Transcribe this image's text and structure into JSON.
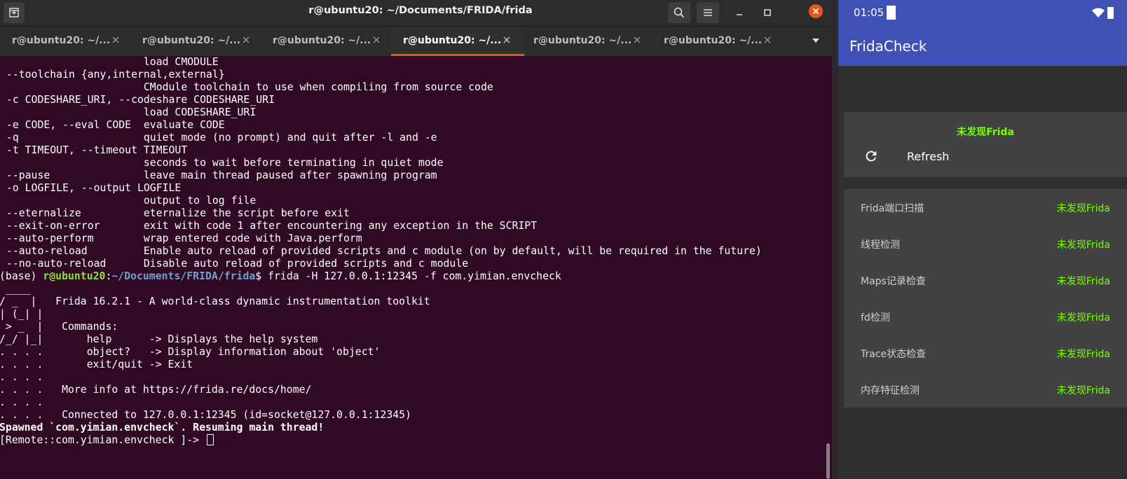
{
  "terminal": {
    "title": "r@ubuntu20: ~/Documents/FRIDA/frida",
    "tabs": [
      {
        "label": "r@ubuntu20: ~/...",
        "active": false
      },
      {
        "label": "r@ubuntu20: ~/...",
        "active": false
      },
      {
        "label": "r@ubuntu20: ~/...",
        "active": false
      },
      {
        "label": "r@ubuntu20: ~/...",
        "active": true
      },
      {
        "label": "r@ubuntu20: ~/...",
        "active": false
      },
      {
        "label": "r@ubuntu20: ~/...",
        "active": false
      }
    ],
    "lines": [
      "                       load CMODULE",
      " --toolchain {any,internal,external}",
      "                       CModule toolchain to use when compiling from source code",
      " -c CODESHARE_URI, --codeshare CODESHARE_URI",
      "                       load CODESHARE_URI",
      " -e CODE, --eval CODE  evaluate CODE",
      " -q                    quiet mode (no prompt) and quit after -l and -e",
      " -t TIMEOUT, --timeout TIMEOUT",
      "                       seconds to wait before terminating in quiet mode",
      " --pause               leave main thread paused after spawning program",
      " -o LOGFILE, --output LOGFILE",
      "                       output to log file",
      " --eternalize          eternalize the script before exit",
      " --exit-on-error       exit with code 1 after encountering any exception in the SCRIPT",
      " --auto-perform        wrap entered code with Java.perform",
      " --auto-reload         Enable auto reload of provided scripts and c module (on by default, will be required in the future)",
      " --no-auto-reload      Disable auto reload of provided scripts and c module"
    ],
    "prompt": {
      "env": "(base) ",
      "user_host": "r@ubuntu20",
      "colon": ":",
      "path": "~/Documents/FRIDA/frida",
      "dollar": "$ ",
      "command": "frida -H 127.0.0.1:12345 -f com.yimian.envcheck"
    },
    "banner": [
      " ____",
      "/ _  |   Frida 16.2.1 - A world-class dynamic instrumentation toolkit",
      "| (_| |",
      " > _  |   Commands:",
      "/_/ |_|       help      -> Displays the help system",
      ". . . .       object?   -> Display information about 'object'",
      ". . . .       exit/quit -> Exit",
      ". . . .",
      ". . . .   More info at https://frida.re/docs/home/",
      ". . . .",
      ". . . .   Connected to 127.0.0.1:12345 (id=socket@127.0.0.1:12345)"
    ],
    "spawned": "Spawned `com.yimian.envcheck`. Resuming main thread!",
    "repl_prompt": "[Remote::com.yimian.envcheck ]-> "
  },
  "android": {
    "status_time": "01:05",
    "app_title": "FridaCheck",
    "overall_status": "未发现Frida",
    "refresh_label": "Refresh",
    "checks": [
      {
        "name": "Frida端口扫描",
        "status": "未发现Frida"
      },
      {
        "name": "线程检测",
        "status": "未发现Frida"
      },
      {
        "name": "Maps记录检查",
        "status": "未发现Frida"
      },
      {
        "name": "fd检测",
        "status": "未发现Frida"
      },
      {
        "name": "Trace状态检查",
        "status": "未发现Frida"
      },
      {
        "name": "内存特征检测",
        "status": "未发现Frida"
      }
    ]
  },
  "colors": {
    "terminal_bg": "#300a24",
    "accent_orange": "#e95420",
    "prompt_green": "#8ae234",
    "prompt_blue": "#729fcf",
    "android_primary": "#3f51b5",
    "status_green": "#76ff03"
  },
  "icons": [
    "new-tab-icon",
    "search-icon",
    "hamburger-menu-icon",
    "minimize-icon",
    "maximize-icon",
    "close-icon",
    "tab-close-icon",
    "chevron-down-icon",
    "wifi-icon",
    "battery-icon",
    "refresh-icon"
  ]
}
